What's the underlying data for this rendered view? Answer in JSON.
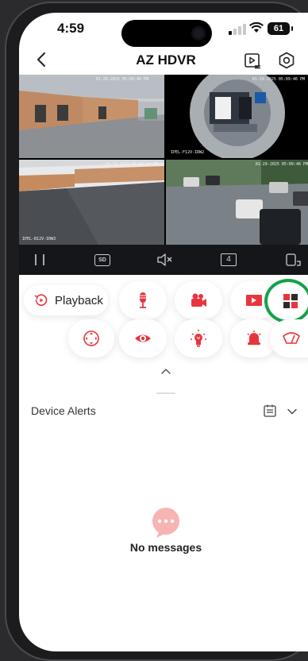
{
  "status_bar": {
    "time": "4:59",
    "battery": "61"
  },
  "header": {
    "title": "AZ HDVR"
  },
  "cameras": [
    {
      "name": "camera-1",
      "timestamp": "01-29-2025  05:09:46 PM",
      "label": ""
    },
    {
      "name": "camera-2",
      "timestamp": "01-29-2025  05:09:46 PM",
      "label": "IPEL-F12V-IRW2"
    },
    {
      "name": "camera-3",
      "timestamp": "01-29-2025  05:09:46 PM",
      "label": "IPEL-B12V-IRW3"
    },
    {
      "name": "camera-4",
      "timestamp": "01-29-2025  05:09:46 PM",
      "label": ""
    }
  ],
  "controls": {
    "quality": "SD",
    "layout_count": "4"
  },
  "functions": {
    "playback_label": "Playback"
  },
  "alerts": {
    "title": "Device Alerts",
    "empty_text": "No messages"
  },
  "colors": {
    "accent": "#e8353d",
    "highlight_ring": "#13a24a",
    "control_bar": "#15161a"
  },
  "icons": [
    "back-icon",
    "playback-list-icon",
    "settings-icon",
    "pause-icon",
    "sd-quality-icon",
    "mute-icon",
    "layout-count-icon",
    "fullscreen-icon",
    "playback-icon",
    "microphone-icon",
    "record-icon",
    "video-icon",
    "multi-view-icon",
    "ptz-icon",
    "eye-icon",
    "light-icon",
    "alarm-icon",
    "wiper-icon",
    "chevron-up-icon",
    "calendar-icon",
    "chevron-down-icon",
    "message-icon"
  ]
}
